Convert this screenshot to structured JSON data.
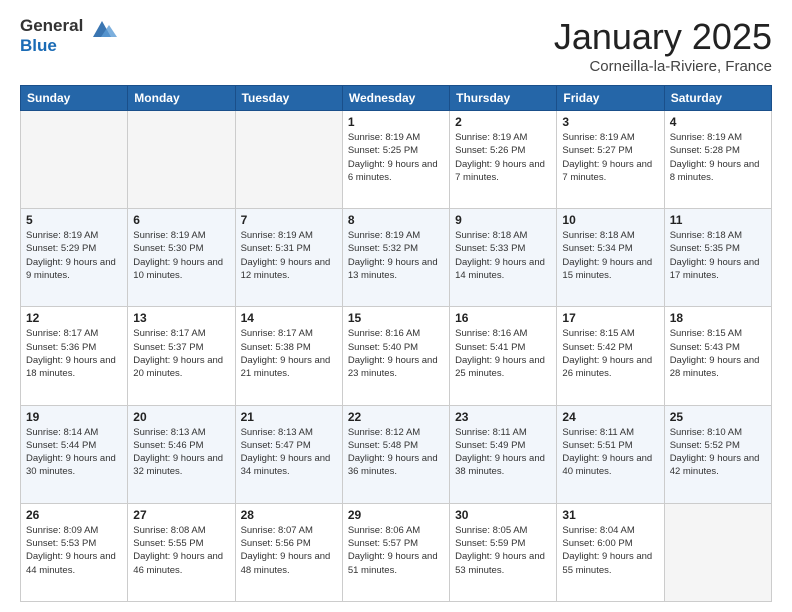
{
  "logo": {
    "line1": "General",
    "line2": "Blue"
  },
  "title": "January 2025",
  "subtitle": "Corneilla-la-Riviere, France",
  "header_days": [
    "Sunday",
    "Monday",
    "Tuesday",
    "Wednesday",
    "Thursday",
    "Friday",
    "Saturday"
  ],
  "weeks": [
    [
      {
        "day": "",
        "info": ""
      },
      {
        "day": "",
        "info": ""
      },
      {
        "day": "",
        "info": ""
      },
      {
        "day": "1",
        "info": "Sunrise: 8:19 AM\nSunset: 5:25 PM\nDaylight: 9 hours and 6 minutes."
      },
      {
        "day": "2",
        "info": "Sunrise: 8:19 AM\nSunset: 5:26 PM\nDaylight: 9 hours and 7 minutes."
      },
      {
        "day": "3",
        "info": "Sunrise: 8:19 AM\nSunset: 5:27 PM\nDaylight: 9 hours and 7 minutes."
      },
      {
        "day": "4",
        "info": "Sunrise: 8:19 AM\nSunset: 5:28 PM\nDaylight: 9 hours and 8 minutes."
      }
    ],
    [
      {
        "day": "5",
        "info": "Sunrise: 8:19 AM\nSunset: 5:29 PM\nDaylight: 9 hours and 9 minutes."
      },
      {
        "day": "6",
        "info": "Sunrise: 8:19 AM\nSunset: 5:30 PM\nDaylight: 9 hours and 10 minutes."
      },
      {
        "day": "7",
        "info": "Sunrise: 8:19 AM\nSunset: 5:31 PM\nDaylight: 9 hours and 12 minutes."
      },
      {
        "day": "8",
        "info": "Sunrise: 8:19 AM\nSunset: 5:32 PM\nDaylight: 9 hours and 13 minutes."
      },
      {
        "day": "9",
        "info": "Sunrise: 8:18 AM\nSunset: 5:33 PM\nDaylight: 9 hours and 14 minutes."
      },
      {
        "day": "10",
        "info": "Sunrise: 8:18 AM\nSunset: 5:34 PM\nDaylight: 9 hours and 15 minutes."
      },
      {
        "day": "11",
        "info": "Sunrise: 8:18 AM\nSunset: 5:35 PM\nDaylight: 9 hours and 17 minutes."
      }
    ],
    [
      {
        "day": "12",
        "info": "Sunrise: 8:17 AM\nSunset: 5:36 PM\nDaylight: 9 hours and 18 minutes."
      },
      {
        "day": "13",
        "info": "Sunrise: 8:17 AM\nSunset: 5:37 PM\nDaylight: 9 hours and 20 minutes."
      },
      {
        "day": "14",
        "info": "Sunrise: 8:17 AM\nSunset: 5:38 PM\nDaylight: 9 hours and 21 minutes."
      },
      {
        "day": "15",
        "info": "Sunrise: 8:16 AM\nSunset: 5:40 PM\nDaylight: 9 hours and 23 minutes."
      },
      {
        "day": "16",
        "info": "Sunrise: 8:16 AM\nSunset: 5:41 PM\nDaylight: 9 hours and 25 minutes."
      },
      {
        "day": "17",
        "info": "Sunrise: 8:15 AM\nSunset: 5:42 PM\nDaylight: 9 hours and 26 minutes."
      },
      {
        "day": "18",
        "info": "Sunrise: 8:15 AM\nSunset: 5:43 PM\nDaylight: 9 hours and 28 minutes."
      }
    ],
    [
      {
        "day": "19",
        "info": "Sunrise: 8:14 AM\nSunset: 5:44 PM\nDaylight: 9 hours and 30 minutes."
      },
      {
        "day": "20",
        "info": "Sunrise: 8:13 AM\nSunset: 5:46 PM\nDaylight: 9 hours and 32 minutes."
      },
      {
        "day": "21",
        "info": "Sunrise: 8:13 AM\nSunset: 5:47 PM\nDaylight: 9 hours and 34 minutes."
      },
      {
        "day": "22",
        "info": "Sunrise: 8:12 AM\nSunset: 5:48 PM\nDaylight: 9 hours and 36 minutes."
      },
      {
        "day": "23",
        "info": "Sunrise: 8:11 AM\nSunset: 5:49 PM\nDaylight: 9 hours and 38 minutes."
      },
      {
        "day": "24",
        "info": "Sunrise: 8:11 AM\nSunset: 5:51 PM\nDaylight: 9 hours and 40 minutes."
      },
      {
        "day": "25",
        "info": "Sunrise: 8:10 AM\nSunset: 5:52 PM\nDaylight: 9 hours and 42 minutes."
      }
    ],
    [
      {
        "day": "26",
        "info": "Sunrise: 8:09 AM\nSunset: 5:53 PM\nDaylight: 9 hours and 44 minutes."
      },
      {
        "day": "27",
        "info": "Sunrise: 8:08 AM\nSunset: 5:55 PM\nDaylight: 9 hours and 46 minutes."
      },
      {
        "day": "28",
        "info": "Sunrise: 8:07 AM\nSunset: 5:56 PM\nDaylight: 9 hours and 48 minutes."
      },
      {
        "day": "29",
        "info": "Sunrise: 8:06 AM\nSunset: 5:57 PM\nDaylight: 9 hours and 51 minutes."
      },
      {
        "day": "30",
        "info": "Sunrise: 8:05 AM\nSunset: 5:59 PM\nDaylight: 9 hours and 53 minutes."
      },
      {
        "day": "31",
        "info": "Sunrise: 8:04 AM\nSunset: 6:00 PM\nDaylight: 9 hours and 55 minutes."
      },
      {
        "day": "",
        "info": ""
      }
    ]
  ]
}
